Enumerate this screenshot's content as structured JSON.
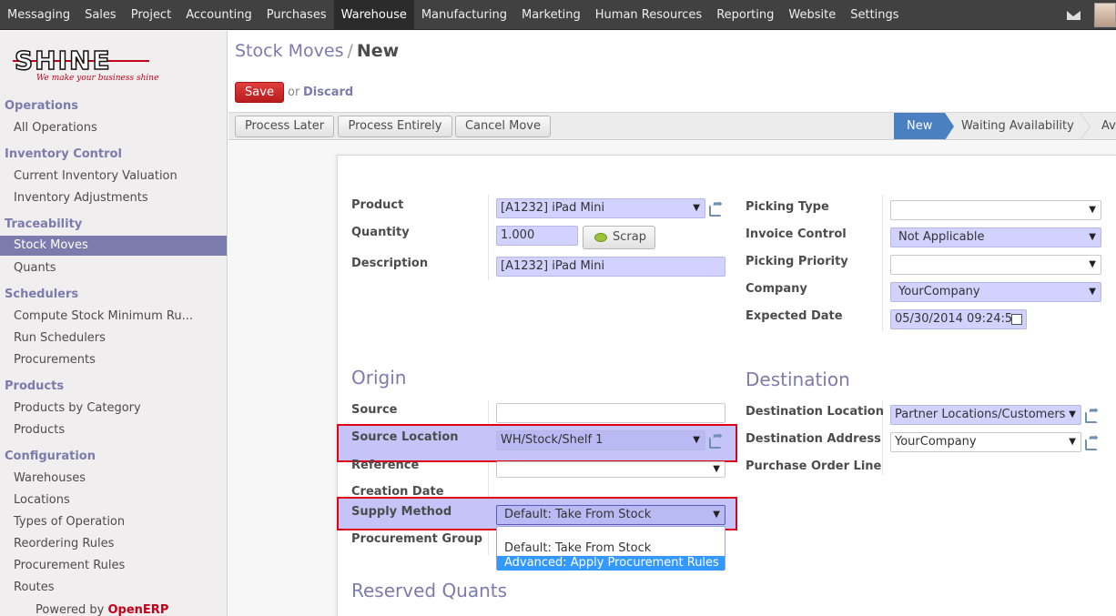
{
  "topbar": {
    "menu": [
      "Messaging",
      "Sales",
      "Project",
      "Accounting",
      "Purchases",
      "Warehouse",
      "Manufacturing",
      "Marketing",
      "Human Resources",
      "Reporting",
      "Website",
      "Settings"
    ],
    "active": "Warehouse",
    "icons": [
      "mail-icon",
      "avatar"
    ]
  },
  "logo": {
    "text": "SHINE",
    "tagline": "We make your business shine"
  },
  "sidebar": {
    "sections": [
      {
        "title": "Operations",
        "items": [
          "All Operations"
        ]
      },
      {
        "title": "Inventory Control",
        "items": [
          "Current Inventory Valuation",
          "Inventory Adjustments"
        ]
      },
      {
        "title": "Traceability",
        "items": [
          "Stock Moves",
          "Quants"
        ]
      },
      {
        "title": "Schedulers",
        "items": [
          "Compute Stock Minimum Ru...",
          "Run Schedulers",
          "Procurements"
        ]
      },
      {
        "title": "Products",
        "items": [
          "Products by Category",
          "Products"
        ]
      },
      {
        "title": "Configuration",
        "items": [
          "Warehouses",
          "Locations",
          "Types of Operation",
          "Reordering Rules",
          "Procurement Rules",
          "Routes"
        ]
      }
    ],
    "active_item": "Stock Moves",
    "powered_prefix": "Powered by",
    "powered_brand": "OpenERP"
  },
  "header": {
    "breadcrumb_parent": "Stock Moves",
    "breadcrumb_sep": "/",
    "breadcrumb_current": "New",
    "save_label": "Save",
    "or_text": "or",
    "discard_label": "Discard"
  },
  "statusbar": {
    "buttons": [
      "Process Later",
      "Process Entirely",
      "Cancel Move"
    ],
    "stages": [
      "New",
      "Waiting Availability",
      "Av"
    ],
    "active_stage": "New"
  },
  "form": {
    "left": {
      "product_label": "Product",
      "product_value": "[A1232] iPad Mini",
      "quantity_label": "Quantity",
      "quantity_value": "1.000",
      "scrap_label": "Scrap",
      "description_label": "Description",
      "description_value": "[A1232] iPad Mini"
    },
    "right": {
      "picking_type_label": "Picking Type",
      "picking_type_value": "",
      "invoice_control_label": "Invoice Control",
      "invoice_control_value": "Not Applicable",
      "picking_priority_label": "Picking Priority",
      "picking_priority_value": "",
      "company_label": "Company",
      "company_value": "YourCompany",
      "expected_date_label": "Expected Date",
      "expected_date_value": "05/30/2014 09:24:5"
    },
    "origin": {
      "title": "Origin",
      "source_label": "Source",
      "source_value": "",
      "source_location_label": "Source Location",
      "source_location_value": "WH/Stock/Shelf 1",
      "reference_label": "Reference",
      "reference_value": "",
      "creation_date_label": "Creation Date",
      "supply_method_label": "Supply Method",
      "supply_method_value": "Default: Take From Stock",
      "procurement_group_label": "Procurement Group"
    },
    "destination": {
      "title": "Destination",
      "destination_location_label": "Destination Location",
      "destination_location_value": "Partner Locations/Customers",
      "destination_address_label": "Destination Address",
      "destination_address_value": "YourCompany",
      "purchase_order_line_label": "Purchase Order Line"
    },
    "supply_method_options": [
      "Default: Take From Stock",
      "Advanced: Apply Procurement Rules"
    ],
    "supply_method_highlighted": "Advanced: Apply Procurement Rules",
    "reserved_quants_title": "Reserved Quants"
  },
  "colors": {
    "accent": "#7c7bad",
    "required_field": "#d2d2ff",
    "save_button": "#c62828",
    "highlight_border": "#e0001a",
    "active_stage": "#4a7fc0"
  }
}
